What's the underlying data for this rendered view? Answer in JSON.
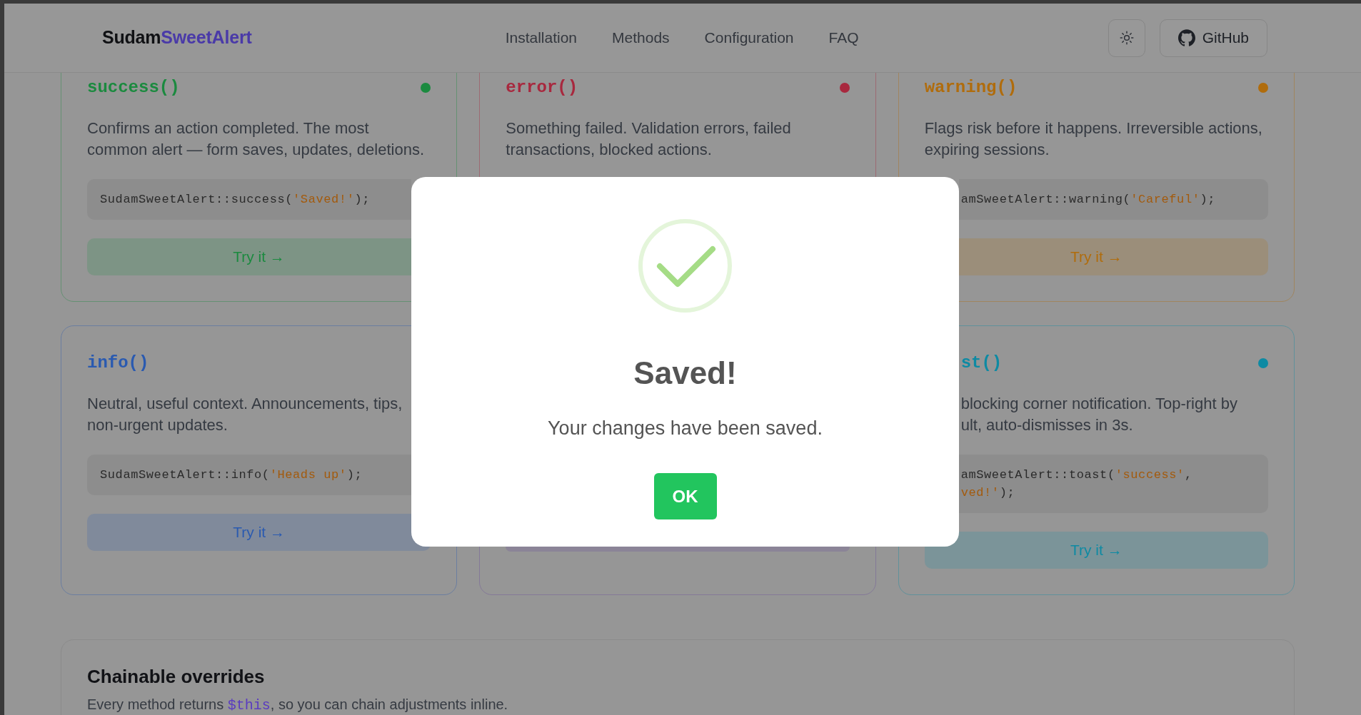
{
  "header": {
    "logo": {
      "name": "Sudam",
      "accent": "SweetAlert"
    },
    "nav": [
      "Installation",
      "Methods",
      "Configuration",
      "FAQ"
    ],
    "github_button": "GitHub"
  },
  "method_cards": [
    {
      "color": "#1b8a3f",
      "title": "success()",
      "dot": true,
      "description": "Confirms an action completed. The most common alert — form saves, updates, deletions.",
      "code_lines": [
        [
          {
            "kind": "plain",
            "text": "SudamSweetAlert::success("
          },
          {
            "kind": "string",
            "text": "'Saved!'"
          },
          {
            "kind": "plain",
            "text": ");"
          }
        ]
      ],
      "try_button": "Try it →"
    },
    {
      "color": "#a8283e",
      "title": "error()",
      "dot": true,
      "description": "Something failed. Validation errors, failed transactions, blocked actions."
    },
    {
      "color": "#b06c0c",
      "title": "warning()",
      "dot": true,
      "description": "Flags risk before it happens. Irreversible actions, expiring sessions.",
      "code_lines": [
        [
          {
            "kind": "plain",
            "text": "amSweetAlert::warning("
          },
          {
            "kind": "string",
            "text": "'Careful'"
          },
          {
            "kind": "plain",
            "text": ");"
          }
        ]
      ],
      "try_button": "Try it →"
    },
    {
      "color": "#2a5ab0",
      "title": "info()",
      "description": "Neutral, useful context. Announcements, tips, non-urgent updates.",
      "code_lines": [
        [
          {
            "kind": "plain",
            "text": "SudamSweetAlert::info("
          },
          {
            "kind": "string",
            "text": "'Heads up'"
          },
          {
            "kind": "plain",
            "text": ");"
          }
        ]
      ],
      "try_button": "Try it →"
    },
    {
      "color": "#8b8497",
      "button_edge": true
    },
    {
      "color": "#0e8aa3",
      "title": "st()",
      "dot": true,
      "description_lines": [
        "blocking corner notification. Top-right by",
        "ult, auto-dismisses in 3s."
      ],
      "code_lines": [
        [
          {
            "kind": "plain",
            "text": "amSweetAlert::toast("
          },
          {
            "kind": "string",
            "text": "'success'"
          },
          {
            "kind": "plain",
            "text": ","
          }
        ],
        [
          {
            "kind": "string",
            "text": "ved!'"
          },
          {
            "kind": "plain",
            "text": ");"
          }
        ]
      ],
      "try_button": "Try it →"
    }
  ],
  "overrides": {
    "title": "Chainable overrides",
    "text": {
      "before": "Every method returns ",
      "code": "$this",
      "after": ", so you can chain adjustments inline."
    }
  },
  "dialog": {
    "title": "Saved!",
    "message": "Your changes have been saved.",
    "confirm_button": "OK"
  }
}
